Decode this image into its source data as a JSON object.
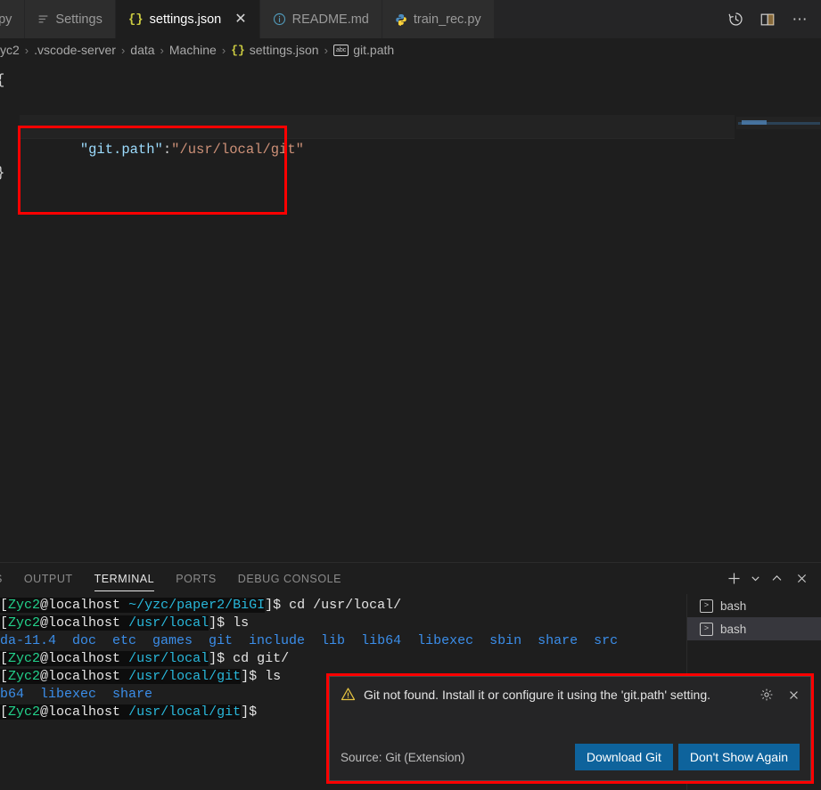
{
  "editor_tabs": [
    {
      "label": "o.py",
      "icon": "python-icon",
      "active": false,
      "clipped": true
    },
    {
      "label": "Settings",
      "icon": "settings-icon",
      "active": false,
      "clipped": false
    },
    {
      "label": "settings.json",
      "icon": "json-icon",
      "active": true,
      "clipped": false,
      "close": "✕"
    },
    {
      "label": "README.md",
      "icon": "markdown-info-icon",
      "active": false,
      "clipped": false
    },
    {
      "label": "train_rec.py",
      "icon": "python-icon",
      "active": false,
      "clipped": false
    }
  ],
  "tabbar_actions": [
    {
      "name": "timeline-history-icon"
    },
    {
      "name": "split-editor-icon"
    },
    {
      "name": "more-actions-icon",
      "glyph": "⋯"
    }
  ],
  "breadcrumb": {
    "separator": "›",
    "segments": [
      {
        "label": "yc2",
        "icon": null
      },
      {
        "label": ".vscode-server",
        "icon": null
      },
      {
        "label": "data",
        "icon": null
      },
      {
        "label": "Machine",
        "icon": null
      },
      {
        "label": "settings.json",
        "icon": "json-icon"
      },
      {
        "label": "git.path",
        "icon": "abc-symbol-icon"
      }
    ]
  },
  "editor": {
    "line1": "{",
    "line3": "}",
    "setting_key": "\"git.path\"",
    "setting_colon": ":",
    "setting_value": "\"/usr/local/git\"",
    "highlight_color": "#fe0000"
  },
  "panel": {
    "tabs": [
      {
        "label": "S",
        "active": false,
        "clipped": true
      },
      {
        "label": "OUTPUT",
        "active": false,
        "clipped": false
      },
      {
        "label": "TERMINAL",
        "active": true,
        "clipped": false
      },
      {
        "label": "PORTS",
        "active": false,
        "clipped": false
      },
      {
        "label": "DEBUG CONSOLE",
        "active": false,
        "clipped": false
      }
    ],
    "actions": [
      {
        "name": "new-terminal-icon",
        "glyph": "＋"
      },
      {
        "name": "terminal-profile-dropdown-icon",
        "glyph": "⌄"
      },
      {
        "name": "maximize-panel-icon",
        "glyph": "⌃"
      },
      {
        "name": "close-panel-icon",
        "glyph": "✕"
      }
    ],
    "terminal_tabs": [
      {
        "label": "bash",
        "active": false
      },
      {
        "label": "bash",
        "active": true
      }
    ]
  },
  "terminal_lines": [
    {
      "id": "line-1",
      "parts": [
        {
          "text": "[",
          "cls": "t-white t-sel"
        },
        {
          "text": "Zyc2",
          "cls": "t-user t-sel"
        },
        {
          "text": "@localhost ",
          "cls": "t-white t-sel"
        },
        {
          "text": "~/yzc/paper2/BiGI",
          "cls": "t-path t-sel"
        },
        {
          "text": "]$ ",
          "cls": "t-white"
        },
        {
          "text": "cd /usr/local/",
          "cls": "t-white"
        }
      ]
    },
    {
      "id": "line-2",
      "parts": [
        {
          "text": "[",
          "cls": "t-white t-sel"
        },
        {
          "text": "Zyc2",
          "cls": "t-user t-sel"
        },
        {
          "text": "@localhost ",
          "cls": "t-white t-sel"
        },
        {
          "text": "/usr/local",
          "cls": "t-path t-sel"
        },
        {
          "text": "]$ ",
          "cls": "t-white"
        },
        {
          "text": "ls",
          "cls": "t-white"
        }
      ]
    },
    {
      "id": "line-3",
      "parts": [
        {
          "text": "da-11.4  doc  etc  games  git  include  lib  lib64  libexec  sbin  share  src",
          "cls": "t-dir"
        }
      ]
    },
    {
      "id": "line-4",
      "parts": [
        {
          "text": "[",
          "cls": "t-white t-sel"
        },
        {
          "text": "Zyc2",
          "cls": "t-user t-sel"
        },
        {
          "text": "@localhost ",
          "cls": "t-white t-sel"
        },
        {
          "text": "/usr/local",
          "cls": "t-path t-sel"
        },
        {
          "text": "]$ ",
          "cls": "t-white"
        },
        {
          "text": "cd git/",
          "cls": "t-white"
        }
      ]
    },
    {
      "id": "line-5",
      "parts": [
        {
          "text": "[",
          "cls": "t-white t-sel"
        },
        {
          "text": "Zyc2",
          "cls": "t-user t-sel"
        },
        {
          "text": "@localhost ",
          "cls": "t-white t-sel"
        },
        {
          "text": "/usr/local/git",
          "cls": "t-path t-sel"
        },
        {
          "text": "]$ ",
          "cls": "t-white"
        },
        {
          "text": "ls",
          "cls": "t-white"
        }
      ]
    },
    {
      "id": "line-6",
      "parts": [
        {
          "text": "b64  libexec  share",
          "cls": "t-dir"
        }
      ]
    },
    {
      "id": "line-7",
      "parts": [
        {
          "text": "[",
          "cls": "t-white t-sel"
        },
        {
          "text": "Zyc2",
          "cls": "t-user t-sel"
        },
        {
          "text": "@localhost ",
          "cls": "t-white t-sel"
        },
        {
          "text": "/usr/local/git",
          "cls": "t-path t-sel"
        },
        {
          "text": "]$",
          "cls": "t-white"
        }
      ]
    }
  ],
  "notification": {
    "message": "Git not found. Install it or configure it using the 'git.path' setting.",
    "source": "Source: Git (Extension)",
    "buttons": [
      {
        "label": "Download Git"
      },
      {
        "label": "Don't Show Again"
      }
    ],
    "gear_icon": "⚙",
    "close_icon": "✕",
    "accent_color": "#0e639c",
    "highlight_color": "#fe0000"
  }
}
